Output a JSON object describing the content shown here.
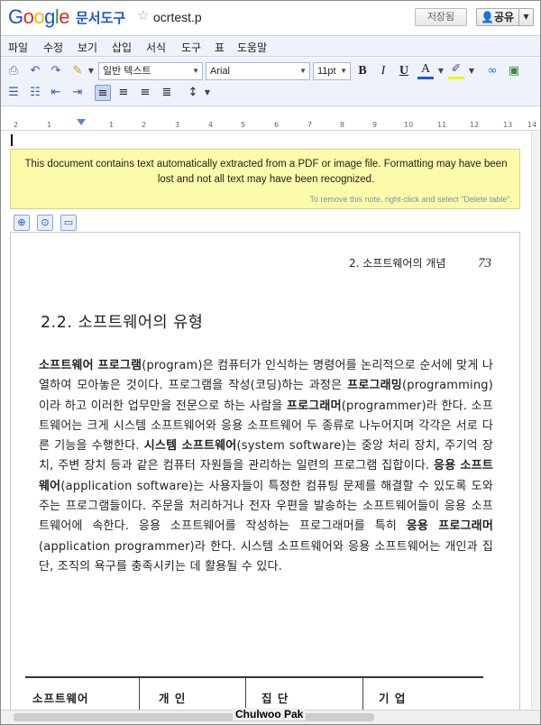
{
  "header": {
    "logo": "Google",
    "product": "문서도구",
    "doc_title": "ocrtest.p",
    "saved_label": "저장됨",
    "share_label": "공유"
  },
  "menubar": [
    "파일",
    "수정",
    "보기",
    "삽입",
    "서식",
    "도구",
    "표",
    "도움말"
  ],
  "toolbar": {
    "style_select": "일반 텍스트",
    "font_select": "Arial",
    "size_select": "11pt",
    "bold": "B",
    "italic": "I",
    "underline": "U",
    "text_color": "A"
  },
  "ruler": {
    "ticks": [
      "2",
      "1",
      "1",
      "2",
      "3",
      "4",
      "5",
      "6",
      "7",
      "8",
      "9",
      "10",
      "11",
      "12",
      "13",
      "14"
    ]
  },
  "note": {
    "message": "This document contains text automatically extracted from a PDF or image file. Formatting may have been lost and not all text may have been recognized.",
    "hint": "To remove this note, right-click and select \"Delete table\"."
  },
  "page": {
    "running_head": "2. 소프트웨어의 개념",
    "page_number": "73",
    "section_title": "2.2.  소프트웨어의 유형",
    "paragraph": [
      {
        "t": "소프트웨어 프로그램",
        "b": true
      },
      {
        "t": "(program)은 컴퓨터가 인식하는 명령어를 논리적으로 순서에 맞게 나열하여 모아놓은 것이다. 프로그램을 작성(코딩)하는 과정은 ",
        "b": false
      },
      {
        "t": "프로그래밍",
        "b": true
      },
      {
        "t": "(programming)이라 하고 이러한 업무만을 전문으로 하는 사람을 ",
        "b": false
      },
      {
        "t": "프로그래머",
        "b": true
      },
      {
        "t": "(programmer)라 한다. 소프트웨어는 크게 시스템 소프트웨어와 응용 소프트웨어 두 종류로 나누어지며 각각은 서로 다른 기능을 수행한다. ",
        "b": false
      },
      {
        "t": "시스템 소프트웨어",
        "b": true
      },
      {
        "t": "(system software)는 중앙 처리 장치, 주기억 장치, 주변 장치 등과 같은 컴퓨터 자원들을 관리하는 일련의 프로그램 집합이다. ",
        "b": false
      },
      {
        "t": "응용 소프트웨어",
        "b": true
      },
      {
        "t": "(application software)는 사용자들이 특정한 컴퓨팅 문제를 해결할 수 있도록 도와주는 프로그램들이다. 주문을 처리하거나 전자 우편을 발송하는 소프트웨어들이 응용 소프트웨어에 속한다. 응용 소프트웨어를 작성하는 프로그래머를 특히 ",
        "b": false
      },
      {
        "t": "응용 프로그래머",
        "b": true
      },
      {
        "t": "(application programmer)라 한다. 시스템 소프트웨어와 응용 소프트웨어는 개인과 집단, 조직의 욕구를 충족시키는 데 활용될 수 있다.",
        "b": false
      }
    ],
    "table_headers": [
      "소프트웨어",
      "개 인",
      "집 단",
      "기 업"
    ]
  },
  "watermark": "Chulwoo Pak"
}
